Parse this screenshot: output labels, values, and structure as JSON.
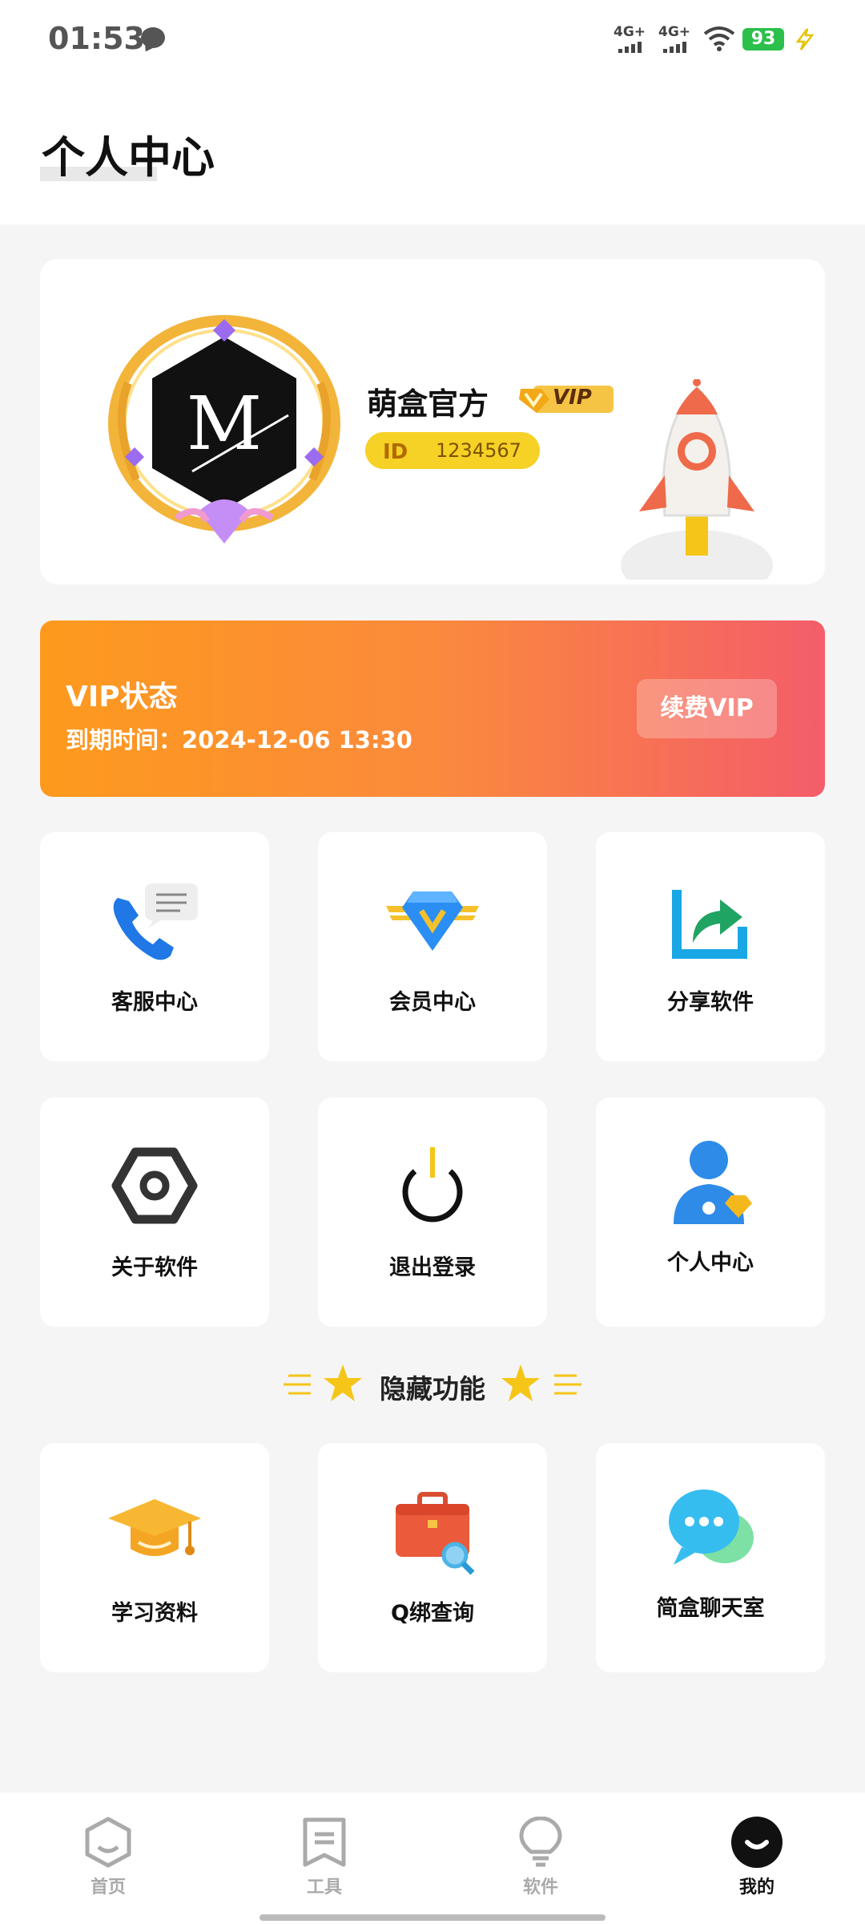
{
  "status_bar": {
    "time": "01:53",
    "signal1": "4G+",
    "signal2": "4G+",
    "battery": "93"
  },
  "header": {
    "title": "个人中心"
  },
  "profile": {
    "nickname": "萌盒官方",
    "vip_badge": "VIP",
    "id_tag": "ID",
    "id_value": "1234567",
    "avatar_letter": "M"
  },
  "vip_banner": {
    "title": "VIP状态",
    "expire": "到期时间：2024-12-06 13:30",
    "renew_label": "续费VIP"
  },
  "grid": [
    {
      "label": "客服中心",
      "icon": "customer-service-icon"
    },
    {
      "label": "会员中心",
      "icon": "member-diamond-icon"
    },
    {
      "label": "分享软件",
      "icon": "share-icon"
    },
    {
      "label": "关于软件",
      "icon": "about-hexagon-icon"
    },
    {
      "label": "退出登录",
      "icon": "power-icon"
    },
    {
      "label": "个人中心",
      "icon": "user-profile-icon"
    }
  ],
  "hidden_section": {
    "title": "隐藏功能",
    "items": [
      {
        "label": "学习资料",
        "icon": "graduation-cap-icon"
      },
      {
        "label": "Q绑查询",
        "icon": "briefcase-search-icon"
      },
      {
        "label": "简盒聊天室",
        "icon": "chat-bubbles-icon"
      }
    ]
  },
  "bottom_nav": [
    {
      "label": "首页",
      "icon": "home-hexagon-icon"
    },
    {
      "label": "工具",
      "icon": "bookmark-tools-icon"
    },
    {
      "label": "软件",
      "icon": "lightbulb-icon"
    },
    {
      "label": "我的",
      "icon": "smile-profile-icon",
      "active": true
    }
  ],
  "colors": {
    "accent_orange": "#fd9a1d",
    "accent_pink": "#f45d6a",
    "id_yellow": "#f6d126",
    "battery_green": "#2bc04b"
  }
}
